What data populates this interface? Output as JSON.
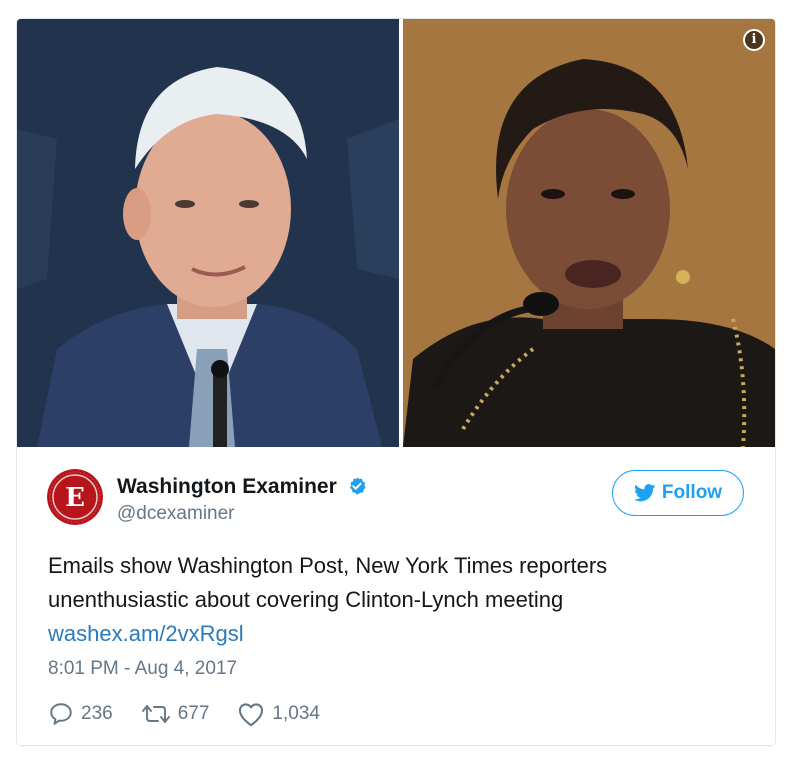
{
  "media": {
    "info_label": "i"
  },
  "author": {
    "name": "Washington Examiner",
    "handle": "@dcexaminer",
    "avatar_letter": "E"
  },
  "follow": {
    "label": "Follow"
  },
  "tweet": {
    "text": "Emails show Washington Post, New York Times reporters unenthusiastic about covering Clinton-Lynch meeting",
    "link": "washex.am/2vxRgsl",
    "timestamp": "8:01 PM - Aug 4, 2017"
  },
  "stats": {
    "replies": "236",
    "retweets": "677",
    "likes": "1,034"
  },
  "colors": {
    "accent": "#1da1f2",
    "link": "#2b7bb9",
    "muted": "#657786",
    "avatar_red": "#b8141c"
  },
  "icons": {
    "verified": "verified-badge-icon",
    "follow": "twitter-bird-icon",
    "reply": "reply-icon",
    "retweet": "retweet-icon",
    "like": "heart-icon",
    "info": "info-icon"
  }
}
